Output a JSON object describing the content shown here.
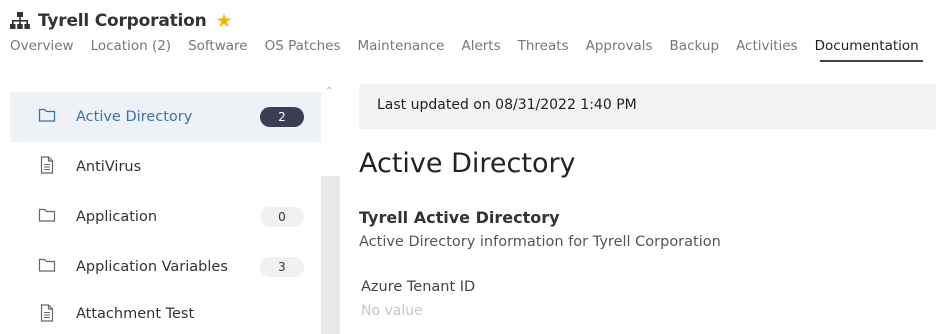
{
  "header": {
    "org_name": "Tyrell Corporation",
    "org_icon": "sitemap-icon",
    "favorite_icon": "star-icon",
    "favorite_color": "#f5b400"
  },
  "tabs": [
    {
      "label": "Overview"
    },
    {
      "label": "Location (2)"
    },
    {
      "label": "Software"
    },
    {
      "label": "OS Patches"
    },
    {
      "label": "Maintenance"
    },
    {
      "label": "Alerts"
    },
    {
      "label": "Threats"
    },
    {
      "label": "Approvals"
    },
    {
      "label": "Backup"
    },
    {
      "label": "Activities"
    },
    {
      "label": "Documentation",
      "active": true
    }
  ],
  "sidebar": {
    "items": [
      {
        "label": "Active Directory",
        "icon": "folder-icon",
        "count": "2",
        "active": true
      },
      {
        "label": "AntiVirus",
        "icon": "document-icon"
      },
      {
        "label": "Application",
        "icon": "folder-icon",
        "count": "0"
      },
      {
        "label": "Application Variables",
        "icon": "folder-icon",
        "count": "3"
      },
      {
        "label": "Attachment Test",
        "icon": "document-icon"
      }
    ]
  },
  "main": {
    "last_updated": "Last updated on 08/31/2022 1:40 PM",
    "title": "Active Directory",
    "asset_name": "Tyrell Active Directory",
    "asset_description": "Active Directory information for Tyrell Corporation",
    "fields": [
      {
        "label": "Azure Tenant ID",
        "value": "No value"
      }
    ]
  },
  "colors": {
    "active_link": "#3a72b0",
    "badge_dark": "#3d3d55",
    "active_row_bg": "#eef2f7"
  }
}
